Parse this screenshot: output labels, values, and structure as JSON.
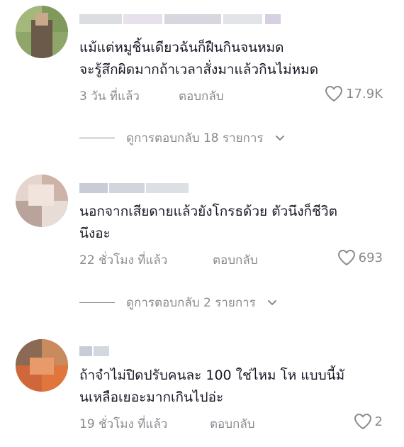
{
  "comments": [
    {
      "text": "แม้แต่หมูชิ้นเดียวฉันก็ฝืนกินจนหมด\nจะรู้สึกผิดมากถ้าเวลาสั่งมาแล้วกินไม่หมด",
      "time": "3 วัน ที่แล้ว",
      "reply_label": "ตอบกลับ",
      "likes": "17.9K",
      "view_replies": "ดูการตอบกลับ 18 รายการ"
    },
    {
      "text": "นอกจากเสียดายแล้วยังโกรธด้วย ตัวนึงก็ชีวิต\nนึงอะ",
      "time": "22 ชั่วโมง ที่แล้ว",
      "reply_label": "ตอบกลับ",
      "likes": "693",
      "view_replies": "ดูการตอบกลับ 2 รายการ"
    },
    {
      "text": "ถ้าจำไม่ปิดปรับคนละ 100 ใช่ไหม โห แบบนี้มั\nนเหลือเยอะมากเกินไปอ่ะ",
      "time": "19 ชั่วโมง ที่แล้ว",
      "reply_label": "ตอบกลับ",
      "likes": "2"
    }
  ],
  "icons": {
    "like": "heart-outline-icon",
    "expand": "chevron-down-icon"
  },
  "colors": {
    "text": "#161823",
    "muted": "#8a8b91"
  }
}
